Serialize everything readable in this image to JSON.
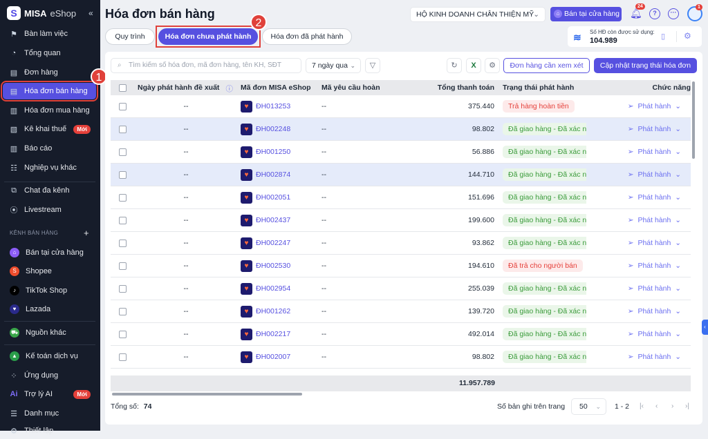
{
  "brand": {
    "name_bold": "MISA",
    "name_light": "eShop",
    "collapse": "«"
  },
  "sidebar": {
    "items": [
      {
        "label": "Bàn làm việc",
        "icon": "⚑"
      },
      {
        "label": "Tổng quan",
        "icon": "◔"
      },
      {
        "label": "Đơn hàng",
        "icon": "▤"
      },
      {
        "label": "Hóa đơn bán hàng",
        "icon": "▤"
      },
      {
        "label": "Hóa đơn mua hàng",
        "icon": "▥"
      },
      {
        "label": "Kê khai thuế",
        "icon": "▧",
        "badge": "Mới"
      },
      {
        "label": "Báo cáo",
        "icon": "▥"
      },
      {
        "label": "Nghiệp vụ khác",
        "icon": "☷"
      },
      {
        "label": "Chat đa kênh",
        "icon": "⧉"
      },
      {
        "label": "Livestream",
        "icon": "⦿"
      }
    ],
    "channels_title": "KÊNH BÁN HÀNG",
    "channels_add": "+",
    "channels": [
      {
        "label": "Bán tại cửa hàng",
        "color": "#8b5cf6",
        "icon": "⌂"
      },
      {
        "label": "Shopee",
        "color": "#ee4d2d",
        "icon": "S"
      },
      {
        "label": "TikTok Shop",
        "color": "#000000",
        "icon": "♪"
      },
      {
        "label": "Lazada",
        "color": "#2a2a8a",
        "icon": "♥"
      }
    ],
    "other": [
      {
        "label": "Nguồn khác",
        "color": "#3aa64a",
        "icon": "⛟"
      },
      {
        "label": "Kế toán dịch vụ",
        "color": "#2a9d4a",
        "icon": "▲"
      },
      {
        "label": "Ứng dụng",
        "icon": "⁘"
      },
      {
        "label": "Trợ lý AI",
        "icon": "Ai",
        "badge": "Mới"
      },
      {
        "label": "Danh mục",
        "icon": "☰"
      },
      {
        "label": "Thiết lập",
        "icon": "⚙"
      }
    ]
  },
  "steps": [
    "1",
    "2"
  ],
  "header": {
    "title": "Hóa đơn bán hàng",
    "shop": "HỘ KINH DOANH CHÂN THIỆN MỸ",
    "store_button": "Bán tại cửa hàng",
    "notif_count": "24",
    "avatar_count": "1"
  },
  "tabs": [
    "Quy trình",
    "Hóa đơn chưa phát hành",
    "Hóa đơn đã phát hành"
  ],
  "quota": {
    "label": "Số HĐ còn được sử dụng:",
    "value": "104.989"
  },
  "toolbar": {
    "search_placeholder": "Tìm kiếm số hóa đơn, mã đơn hàng, tên KH, SĐT",
    "period": "7 ngày qua",
    "review_button": "Đơn hàng cần xem xét",
    "update_button": "Cập nhật trạng thái hóa đơn"
  },
  "table": {
    "columns": [
      "Ngày phát hành đề xuất",
      "Mã đơn MISA eShop",
      "Mã yêu cầu hoàn",
      "Tổng thanh toán",
      "Trạng thái phát hành",
      "Chức năng"
    ],
    "rows": [
      {
        "date": "--",
        "order": "ĐH013253",
        "refund": "--",
        "total": "375.440",
        "status": "Trả hàng hoàn tiền",
        "status_type": "r",
        "action": "Phát hành"
      },
      {
        "date": "--",
        "order": "ĐH002248",
        "refund": "--",
        "total": "98.802",
        "status": "Đã giao hàng - Đã xác nhận",
        "status_type": "g",
        "action": "Phát hành"
      },
      {
        "date": "--",
        "order": "ĐH001250",
        "refund": "--",
        "total": "56.886",
        "status": "Đã giao hàng - Đã xác nhận",
        "status_type": "g",
        "action": "Phát hành"
      },
      {
        "date": "--",
        "order": "ĐH002874",
        "refund": "--",
        "total": "144.710",
        "status": "Đã giao hàng - Đã xác nhận",
        "status_type": "g",
        "action": "Phát hành"
      },
      {
        "date": "--",
        "order": "ĐH002051",
        "refund": "--",
        "total": "151.696",
        "status": "Đã giao hàng - Đã xác nhận",
        "status_type": "g",
        "action": "Phát hành"
      },
      {
        "date": "--",
        "order": "ĐH002437",
        "refund": "--",
        "total": "199.600",
        "status": "Đã giao hàng - Đã xác nhận",
        "status_type": "g",
        "action": "Phát hành"
      },
      {
        "date": "--",
        "order": "ĐH002247",
        "refund": "--",
        "total": "93.862",
        "status": "Đã giao hàng - Đã xác nhận",
        "status_type": "g",
        "action": "Phát hành"
      },
      {
        "date": "--",
        "order": "ĐH002530",
        "refund": "--",
        "total": "194.610",
        "status": "Đã trả cho người bán",
        "status_type": "r",
        "action": "Phát hành"
      },
      {
        "date": "--",
        "order": "ĐH002954",
        "refund": "--",
        "total": "255.039",
        "status": "Đã giao hàng - Đã xác nhận",
        "status_type": "g",
        "action": "Phát hành"
      },
      {
        "date": "--",
        "order": "ĐH001262",
        "refund": "--",
        "total": "139.720",
        "status": "Đã giao hàng - Đã xác nhận",
        "status_type": "g",
        "action": "Phát hành"
      },
      {
        "date": "--",
        "order": "ĐH002217",
        "refund": "--",
        "total": "492.014",
        "status": "Đã giao hàng - Đã xác nhận",
        "status_type": "g",
        "action": "Phát hành"
      },
      {
        "date": "--",
        "order": "ĐH002007",
        "refund": "--",
        "total": "98.802",
        "status": "Đã giao hàng - Đã xác nhận",
        "status_type": "g",
        "action": "Phát hành"
      }
    ],
    "sum_total": "11.957.789"
  },
  "footer": {
    "total_label": "Tổng số:",
    "total": "74",
    "page_size_label": "Số bản ghi trên trang",
    "page_size": "50",
    "range": "1 - 2"
  }
}
